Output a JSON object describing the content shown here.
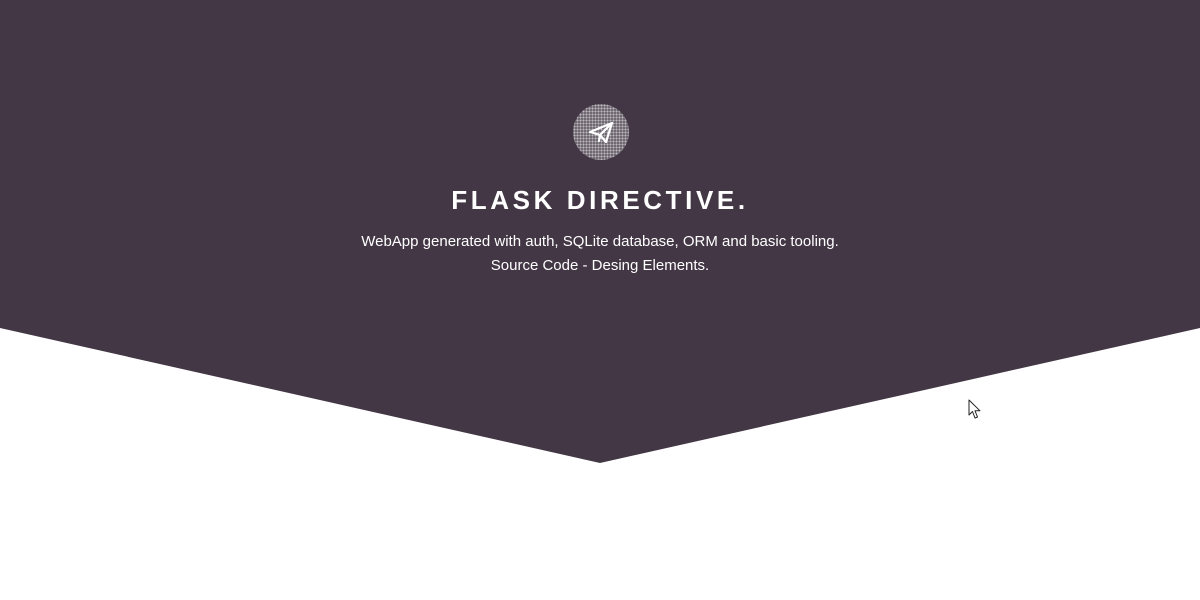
{
  "banner": {
    "background_color": "#433745",
    "page_background": "#ffffff",
    "logo_icon": "paper-plane-icon",
    "title": "FLASK DIRECTIVE.",
    "description_line1": "WebApp generated with auth, SQLite database, ORM and basic tooling.",
    "description_line2": "Source Code - Desing Elements."
  },
  "cursor": {
    "icon": "mouse-pointer-icon"
  }
}
